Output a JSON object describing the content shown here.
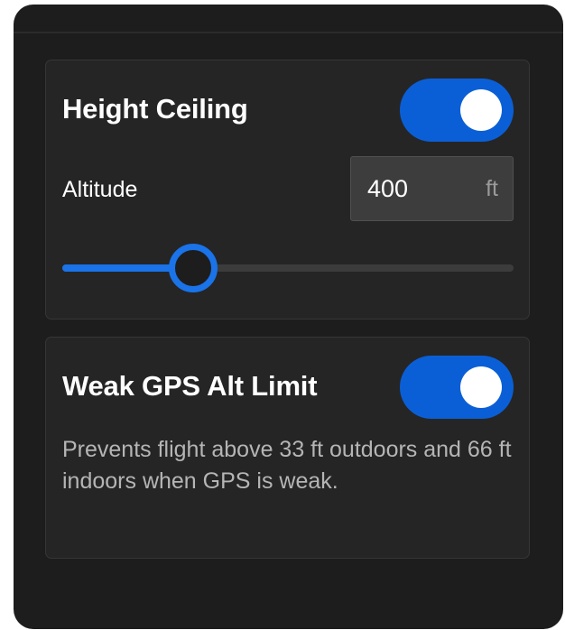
{
  "height_ceiling": {
    "title": "Height Ceiling",
    "enabled": true,
    "altitude_label": "Altitude",
    "altitude_value": "400",
    "altitude_unit": "ft",
    "slider_fraction": 0.29
  },
  "weak_gps": {
    "title": "Weak GPS Alt Limit",
    "enabled": true,
    "description": "Prevents flight above 33 ft outdoors and 66 ft indoors when GPS is weak."
  },
  "colors": {
    "accent": "#0b5fd6",
    "panel": "#1d1d1d",
    "card": "#252525"
  }
}
